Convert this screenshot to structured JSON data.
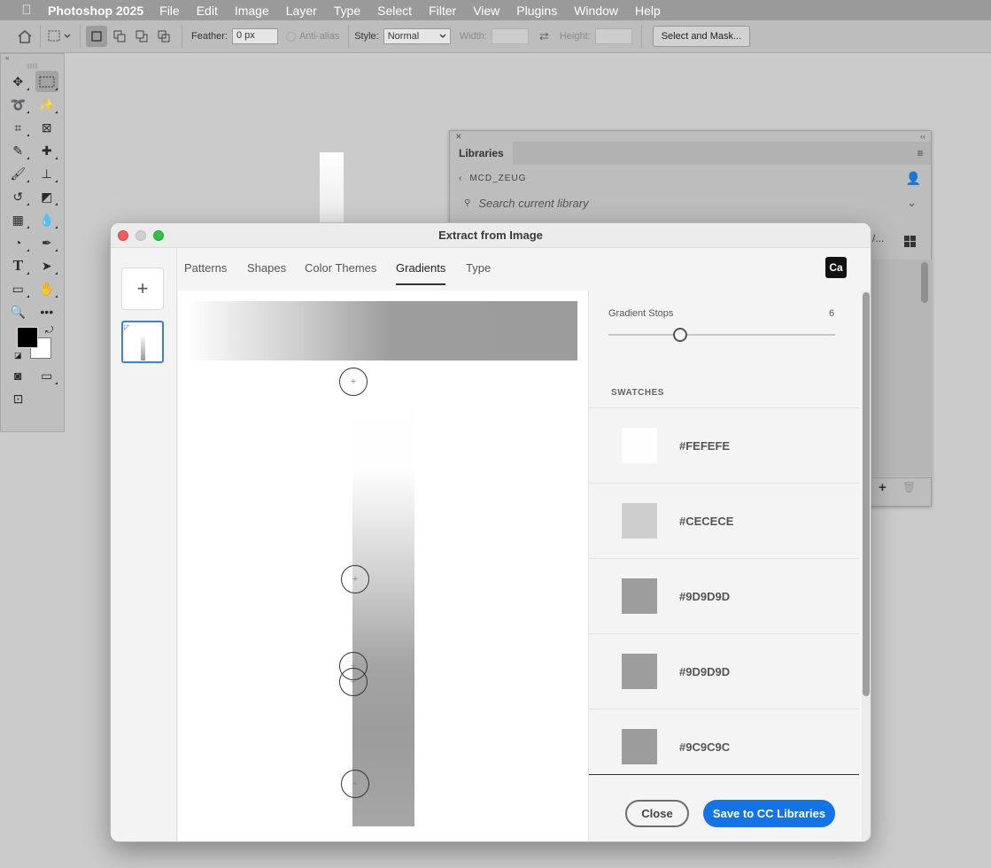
{
  "menubar": {
    "app_name": "Photoshop 2025",
    "items": [
      "File",
      "Edit",
      "Image",
      "Layer",
      "Type",
      "Select",
      "Filter",
      "View",
      "Plugins",
      "Window",
      "Help"
    ]
  },
  "options_bar": {
    "feather_label": "Feather:",
    "feather_value": "0 px",
    "antialias_label": "Anti-alias",
    "style_label": "Style:",
    "style_value": "Normal",
    "width_label": "Width:",
    "height_label": "Height:",
    "select_mask_label": "Select and Mask..."
  },
  "libraries_panel": {
    "tab_label": "Libraries",
    "library_name": "MCD_ZEUG",
    "search_placeholder": "Search current library",
    "view_toggle": "/..."
  },
  "dialog": {
    "title": "Extract from Image",
    "add_label": "+",
    "tabs": [
      "Patterns",
      "Shapes",
      "Color Themes",
      "Gradients",
      "Type"
    ],
    "active_tab": "Gradients",
    "ca_badge": "Ca",
    "gradient_stops_label": "Gradient Stops",
    "gradient_stops_value": "6",
    "swatches_header": "SWATCHES",
    "swatches": [
      {
        "hex": "#FEFEFE",
        "color": "#fefefe"
      },
      {
        "hex": "#CECECE",
        "color": "#cecece"
      },
      {
        "hex": "#9D9D9D",
        "color": "#9d9d9d"
      },
      {
        "hex": "#9D9D9D",
        "color": "#9d9d9d"
      },
      {
        "hex": "#9C9C9C",
        "color": "#9c9c9c"
      }
    ],
    "close_label": "Close",
    "save_label": "Save to CC Libraries"
  },
  "colors": {
    "accent": "#1473e6",
    "menubar_bg": "#9a9a9a"
  }
}
